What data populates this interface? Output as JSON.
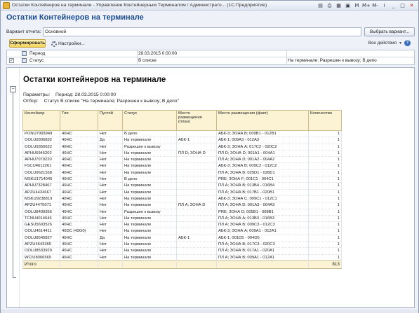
{
  "window": {
    "title": "Остатки Контейнеров на терминале - Управление Контейнерным Терминалом / Администрато... (1С:Предприятие)",
    "icons": [
      "save-icon",
      "print-icon",
      "calendar-icon",
      "calculator-icon",
      "memory-icon",
      "bookmark-icon",
      "info-icon",
      "minimize-icon",
      "maximize-icon",
      "close-icon"
    ],
    "icon_glyphs": [
      "▤",
      "⎙",
      "▦",
      "▣",
      "M",
      "M+",
      "M-",
      "i",
      "_",
      "□",
      "✕"
    ]
  },
  "form": {
    "heading": "Остатки Контейнеров на терминале",
    "variant_label": "Вариант отчета:",
    "variant_value": "Основной",
    "choose_variant_button": "Выбрать вариант...",
    "generate_button": "Сформировать",
    "settings_button": "Настройки...",
    "all_actions": "Все действия",
    "help": "?"
  },
  "params": [
    {
      "checked": false,
      "name": "Период",
      "value": "28.03.2015 0:00:00",
      "extra": ""
    },
    {
      "checked": true,
      "name": "Статус",
      "value": "В списке",
      "extra": "На терминале; Разрешен к вывозу; В депо"
    }
  ],
  "report": {
    "title": "Остатки контейнеров на терминале",
    "params_label": "Параметры:",
    "params_text": "Период: 28.03.2015 0:00:00",
    "selection_label": "Отбор:",
    "selection_text": "Статус В списке \"На терминале; Разрешен к вывозу; В депо\"",
    "columns": [
      "Контейнер",
      "Тип",
      "Пустой",
      "Статус",
      "Место размещения (план)",
      "Место размещения (факт)",
      "Количество"
    ],
    "rows": [
      [
        "PONU7993949",
        "40HC",
        "Нет",
        "В депо",
        "",
        "АБК-3; ЗОНА В; 009В1 - 012В1",
        "1"
      ],
      [
        "OOLU9306832",
        "40HC",
        "Да",
        "На терминале",
        "АБК-1",
        "АБК-1; 009А3 - 012А3",
        "1"
      ],
      [
        "OOLU9356622",
        "40HC",
        "Нет",
        "Разрешен к вывозу",
        "",
        "АБК-3; ЗОНА А; 017С2 - 020С2",
        "1"
      ],
      [
        "APHU6946202",
        "40HC",
        "Нет",
        "На терминале",
        "ПЛ D; ЗОНА D",
        "ПЛ D; ЗОНА D; 001А1 - 004А1",
        "1"
      ],
      [
        "APHU7079220",
        "40HC",
        "Нет",
        "На терминале",
        "",
        "ПЛ А; ЗОНА D; 001А2 - 004А2",
        "1"
      ],
      [
        "FSCU4612261",
        "40HC",
        "Нет",
        "На терминале",
        "",
        "АБК-3; ЗОНА В; 009С2 - 012С2",
        "1"
      ],
      [
        "OOLU9621558",
        "40HC",
        "Нет",
        "На терминале",
        "",
        "ПЛ А; ЗОНА В; 025D1 - 028D1",
        "1"
      ],
      [
        "MSKU1714040",
        "40HC",
        "Нет",
        "В депо",
        "",
        "PRE; ЗОНА F; 001С1 - 004С1",
        "1"
      ],
      [
        "APHU7328467",
        "40HC",
        "Нет",
        "На терминале",
        "",
        "ПЛ А; ЗОНА В; 013В4 - 016В4",
        "1"
      ],
      [
        "APZU4434667",
        "40HC",
        "Нет",
        "На терминале",
        "",
        "ПЛ А; ЗОНА В; 017В1 - 020В1",
        "1"
      ],
      [
        "MSKU9238819",
        "40HC",
        "Нет",
        "На терминале",
        "",
        "АБК-3; ЗОНА С; 009С1 - 012С1",
        "1"
      ],
      [
        "APZU4475071",
        "40HC",
        "Нет",
        "На терминале",
        "ПЛ А; ЗОНА D",
        "ПЛ А; ЗОНА D; 001А3 - 004А3",
        "1"
      ],
      [
        "OOLU8400356",
        "40HC",
        "Нет",
        "Разрешен к вывозу",
        "",
        "PRE; ЗОНА D; 005В1 - 008В1",
        "1"
      ],
      [
        "TCNU4014646",
        "40HC",
        "Нет",
        "На терминале",
        "",
        "ПЛ А; ЗОНА А; 013В3 - 016В3",
        "1"
      ],
      [
        "GESU5693526",
        "40HC",
        "Нет",
        "На терминале",
        "",
        "ПЛ А; ЗОНА В; 009С3 - 012С3",
        "1"
      ],
      [
        "OOLU4514411",
        "40DC (42G0)",
        "Нет",
        "На терминале",
        "",
        "АБК-3; ЗОНА А; 009А1 - 012А1",
        "1"
      ],
      [
        "OOLU8545827",
        "40HC",
        "Да",
        "На терминале",
        "АБК-1",
        "АБК-1; 001D5 - 004D5",
        "1"
      ],
      [
        "APZU4643365",
        "40HC",
        "Нет",
        "На терминале",
        "",
        "ПЛ А; ЗОНА В; 017С3 - 020С3",
        "1"
      ],
      [
        "OOLU8533929",
        "40HC",
        "Нет",
        "На терминале",
        "",
        "ПЛ А; ЗОНА В; 017А1 - 020А1",
        "1"
      ],
      [
        "WCIU8006569",
        "40HC",
        "Нет",
        "На терминале",
        "",
        "ПЛ А; ЗОНА В; 009А1 - 012А1",
        "1"
      ]
    ],
    "total_label": "Итого",
    "total_value": "813"
  }
}
